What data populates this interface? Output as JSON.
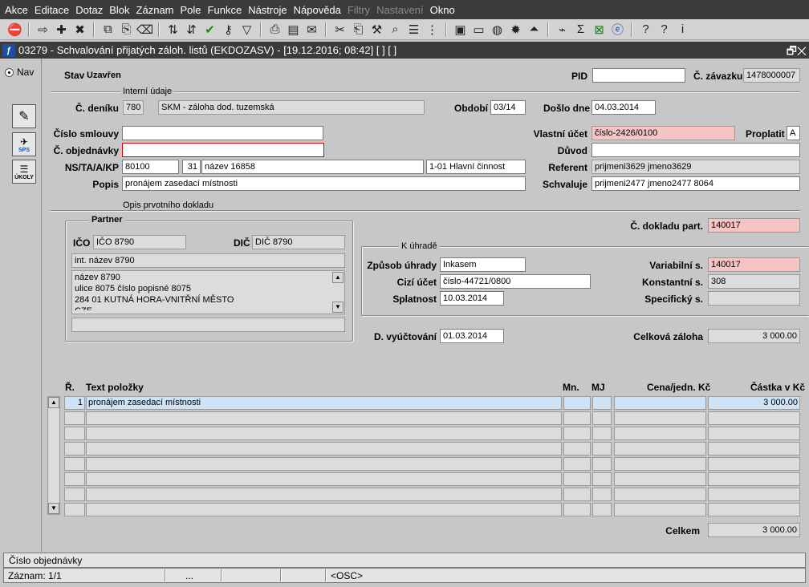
{
  "menu": [
    "Akce",
    "Editace",
    "Dotaz",
    "Blok",
    "Záznam",
    "Pole",
    "Funkce",
    "Nástroje",
    "Nápověda",
    "Filtry",
    "Nastavení",
    "Okno"
  ],
  "menu_disabled": [
    "Filtry",
    "Nastavení"
  ],
  "toolbar_icons": [
    "exit-icon",
    "insert-record-icon",
    "new-record-icon",
    "delete-record-icon",
    "duplicate-icon",
    "copy-icon",
    "clear-icon",
    "sort-asc-icon",
    "sort-desc-icon",
    "check-icon",
    "key-icon",
    "filter-icon",
    "print-icon",
    "print-preview-icon",
    "mail-icon",
    "cut-icon",
    "paste-icon",
    "tools-icon",
    "search-icon",
    "list-icon",
    "tree-icon",
    "documents-icon",
    "notes-icon",
    "globe-icon",
    "settings-icon",
    "signal-icon",
    "stats-icon",
    "sum-icon",
    "excel-icon",
    "ie-icon",
    "help-icon",
    "about-icon",
    "info-icon"
  ],
  "window": {
    "title": "03279 - Schvalování přijatých záloh. listů (EKDOZASV) - [19.12.2016; 08:42] [ ] [ ]",
    "controls": "🗗✕"
  },
  "left": {
    "nav_label": "Nav",
    "sps_label": "SPS",
    "ukoly_label": "ÚKOLY"
  },
  "form": {
    "stav_label": "Stav",
    "stav_value": "Uzavřen",
    "pid_label": "PID",
    "pid_value": "",
    "zavazek_label": "Č. závazku",
    "zavazek_value": "1478000007",
    "section_interni": "Interní údaje",
    "denik_label": "Č. deníku",
    "denik_code": "780",
    "denik_name": "SKM - záloha dod. tuzemská",
    "obdobi_label": "Období",
    "obdobi_value": "03/14",
    "doslo_label": "Došlo dne",
    "doslo_value": "04.03.2014",
    "smlouva_label": "Číslo smlouvy",
    "smlouva_value": "",
    "objednavka_label": "Č. objednávky",
    "objednavka_value": "",
    "vlastni_ucet_label": "Vlastní účet",
    "vlastni_ucet_value": "číslo-2426/0100",
    "proplatit_label": "Proplatit",
    "proplatit_value": "A",
    "duvod_label": "Důvod",
    "duvod_value": "",
    "nstakp_label": "NS/TA/A/KP",
    "ns_value": "80100",
    "ta_value": "31",
    "a_value": "název 16858",
    "kp_value": "1-01 Hlavní činnost",
    "referent_label": "Referent",
    "referent_value": "prijmeni3629 jmeno3629",
    "popis_label": "Popis",
    "popis_value": "pronájem zasedací místnosti",
    "schvaluje_label": "Schvaluje",
    "schvaluje_value": "prijmeni2477 jmeno2477 8064",
    "section_opis": "Opis prvotního dokladu",
    "partner_title": "Partner",
    "ico_label": "IČO",
    "ico_value": "IČO 8790",
    "dic_label": "DIČ",
    "dic_value": "DIČ 8790",
    "int_nazev": "int. název 8790",
    "address_lines": [
      "název 8790",
      "ulice 8075 číslo popisné 8075",
      "284 01 KUTNÁ HORA-VNITŘNÍ MĚSTO",
      "CZE"
    ],
    "partner_extra": "",
    "doklad_part_label": "Č. dokladu part.",
    "doklad_part_value": "140017",
    "k_uhrade_title": "K úhradě",
    "zpusob_label": "Způsob úhrady",
    "zpusob_value": "Inkasem",
    "cizi_ucet_label": "Cizí účet",
    "cizi_ucet_value": "číslo-44721/0800",
    "splatnost_label": "Splatnost",
    "splatnost_value": "10.03.2014",
    "vs_label": "Variabilní s.",
    "vs_value": "140017",
    "ks_label": "Konstantní s.",
    "ks_value": "308",
    "ss_label": "Specifický s.",
    "ss_value": "",
    "vyuctovani_label": "D. vyúčtování",
    "vyuctovani_value": "01.03.2014",
    "celkova_zaloha_label": "Celková záloha",
    "celkova_zaloha_value": "3 000.00"
  },
  "grid": {
    "headers": {
      "r": "Ř.",
      "text": "Text položky",
      "mn": "Mn.",
      "mj": "MJ",
      "cena": "Cena/jedn. Kč",
      "castka": "Částka v Kč"
    },
    "rows": [
      {
        "r": "1",
        "text": "pronájem zasedací místnosti",
        "mn": "",
        "mj": "",
        "cena": "",
        "castka": "3 000.00"
      },
      {
        "r": "",
        "text": "",
        "mn": "",
        "mj": "",
        "cena": "",
        "castka": ""
      },
      {
        "r": "",
        "text": "",
        "mn": "",
        "mj": "",
        "cena": "",
        "castka": ""
      },
      {
        "r": "",
        "text": "",
        "mn": "",
        "mj": "",
        "cena": "",
        "castka": ""
      },
      {
        "r": "",
        "text": "",
        "mn": "",
        "mj": "",
        "cena": "",
        "castka": ""
      },
      {
        "r": "",
        "text": "",
        "mn": "",
        "mj": "",
        "cena": "",
        "castka": ""
      },
      {
        "r": "",
        "text": "",
        "mn": "",
        "mj": "",
        "cena": "",
        "castka": ""
      },
      {
        "r": "",
        "text": "",
        "mn": "",
        "mj": "",
        "cena": "",
        "castka": ""
      }
    ],
    "celkem_label": "Celkem",
    "celkem_value": "3 000.00"
  },
  "status": {
    "message": "Číslo objednávky",
    "zaznam": "Záznam: 1/1",
    "dots": "...",
    "osc": "<OSC>"
  }
}
